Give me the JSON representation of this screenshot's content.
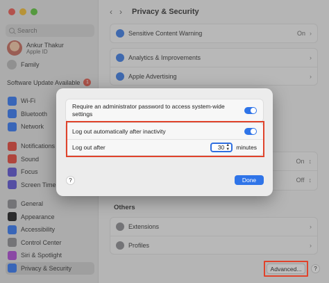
{
  "window": {
    "title": "Privacy & Security"
  },
  "search": {
    "placeholder": "Search"
  },
  "account": {
    "name": "Ankur Thakur",
    "subtitle": "Apple ID"
  },
  "family": {
    "label": "Family"
  },
  "update": {
    "label": "Software Update Available",
    "count": "1"
  },
  "sidebar": {
    "group1": [
      {
        "label": "Wi-Fi",
        "icon": "wifi-icon",
        "color": "#3478f6"
      },
      {
        "label": "Bluetooth",
        "icon": "bluetooth-icon",
        "color": "#3478f6"
      },
      {
        "label": "Network",
        "icon": "network-icon",
        "color": "#3478f6"
      }
    ],
    "group2": [
      {
        "label": "Notifications",
        "icon": "notifications-icon",
        "color": "#e9453a"
      },
      {
        "label": "Sound",
        "icon": "sound-icon",
        "color": "#e9453a"
      },
      {
        "label": "Focus",
        "icon": "focus-icon",
        "color": "#5c54d6"
      },
      {
        "label": "Screen Time",
        "icon": "screen-time-icon",
        "color": "#5c54d6"
      }
    ],
    "group3": [
      {
        "label": "General",
        "icon": "general-icon",
        "color": "#8e8e93"
      },
      {
        "label": "Appearance",
        "icon": "appearance-icon",
        "color": "#1c1c1e"
      },
      {
        "label": "Accessibility",
        "icon": "accessibility-icon",
        "color": "#3478f6"
      },
      {
        "label": "Control Center",
        "icon": "control-center-icon",
        "color": "#8e8e93"
      },
      {
        "label": "Siri & Spotlight",
        "icon": "siri-icon",
        "color": "#b04ad8"
      },
      {
        "label": "Privacy & Security",
        "icon": "privacy-icon",
        "color": "#3478f6",
        "active": true
      }
    ]
  },
  "main": {
    "rows_top": [
      {
        "label": "Sensitive Content Warning",
        "value": "On"
      }
    ],
    "rows_mid": [
      {
        "label": "Analytics & Improvements"
      },
      {
        "label": "Apple Advertising"
      }
    ],
    "hidden_values": [
      "On",
      "Off"
    ],
    "others_label": "Others",
    "others_rows": [
      {
        "label": "Extensions"
      },
      {
        "label": "Profiles"
      }
    ],
    "advanced_label": "Advanced...",
    "help_label": "?"
  },
  "dialog": {
    "row1": "Require an administrator password to access system-wide settings",
    "row2": "Log out automatically after inactivity",
    "row3": "Log out after",
    "minutes_value": "30",
    "minutes_unit": "minutes",
    "help_label": "?",
    "done_label": "Done",
    "toggles": {
      "require_admin": true,
      "auto_logout": true
    }
  }
}
